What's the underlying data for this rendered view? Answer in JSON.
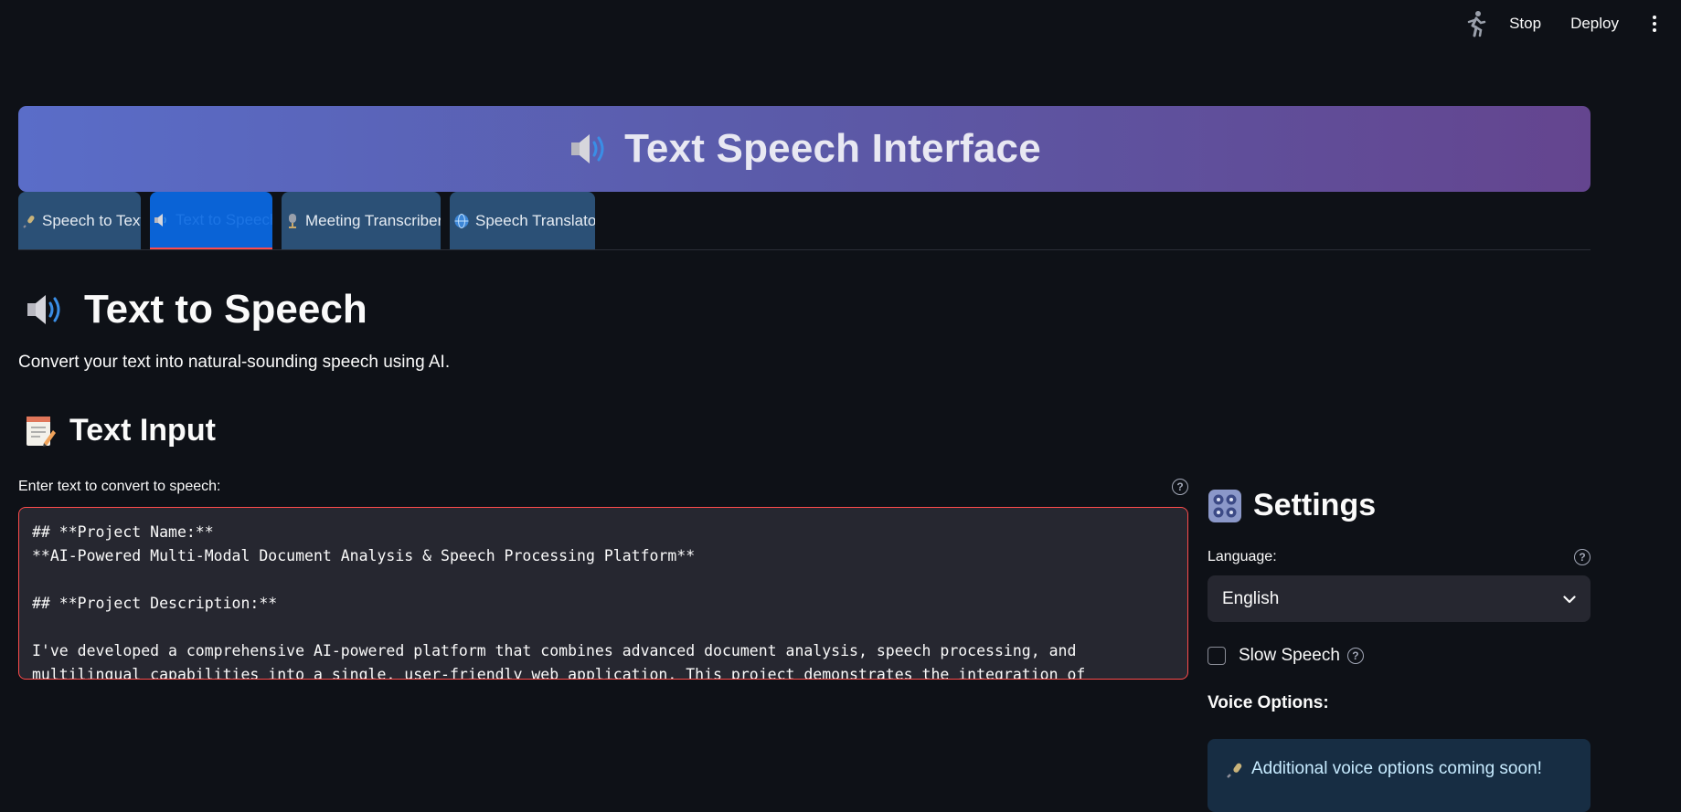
{
  "toolbar": {
    "run_icon": "running-person-icon",
    "stop_label": "Stop",
    "deploy_label": "Deploy",
    "menu_icon": "kebab-menu-icon"
  },
  "banner": {
    "icon": "speaker-icon",
    "title": "Text Speech Interface"
  },
  "tabs": [
    {
      "icon": "microphone-icon",
      "label": "Speech to Text",
      "active": false
    },
    {
      "icon": "speaker-icon",
      "label": "Text to Speech",
      "active": true
    },
    {
      "icon": "studio-microphone-icon",
      "label": "Meeting Transcriber",
      "active": false
    },
    {
      "icon": "globe-icon",
      "label": "Speech Translator",
      "active": false
    }
  ],
  "page": {
    "icon": "speaker-icon",
    "title": "Text to Speech",
    "description": "Convert your text into natural-sounding speech using AI."
  },
  "text_input": {
    "icon": "memo-icon",
    "heading": "Text Input",
    "label": "Enter text to convert to speech:",
    "value": "## **Project Name:**\n**AI-Powered Multi-Modal Document Analysis & Speech Processing Platform**\n\n## **Project Description:**\n\nI've developed a comprehensive AI-powered platform that combines advanced document analysis, speech processing, and\nmultilingual capabilities into a single, user-friendly web application. This project demonstrates the integration of"
  },
  "settings": {
    "icon": "control-knobs-icon",
    "heading": "Settings",
    "language_label": "Language:",
    "language_value": "English",
    "slow_speech_label": "Slow Speech",
    "slow_speech_checked": false,
    "voice_options_label": "Voice Options:",
    "voice_info_icon": "microphone-icon",
    "voice_info_text": "Additional voice options coming soon!"
  },
  "colors": {
    "background": "#0e1117",
    "accent": "#ff4b4b",
    "active_tab": "#0a63d6",
    "tab": "#2b5076",
    "info_bg": "#172d43"
  }
}
